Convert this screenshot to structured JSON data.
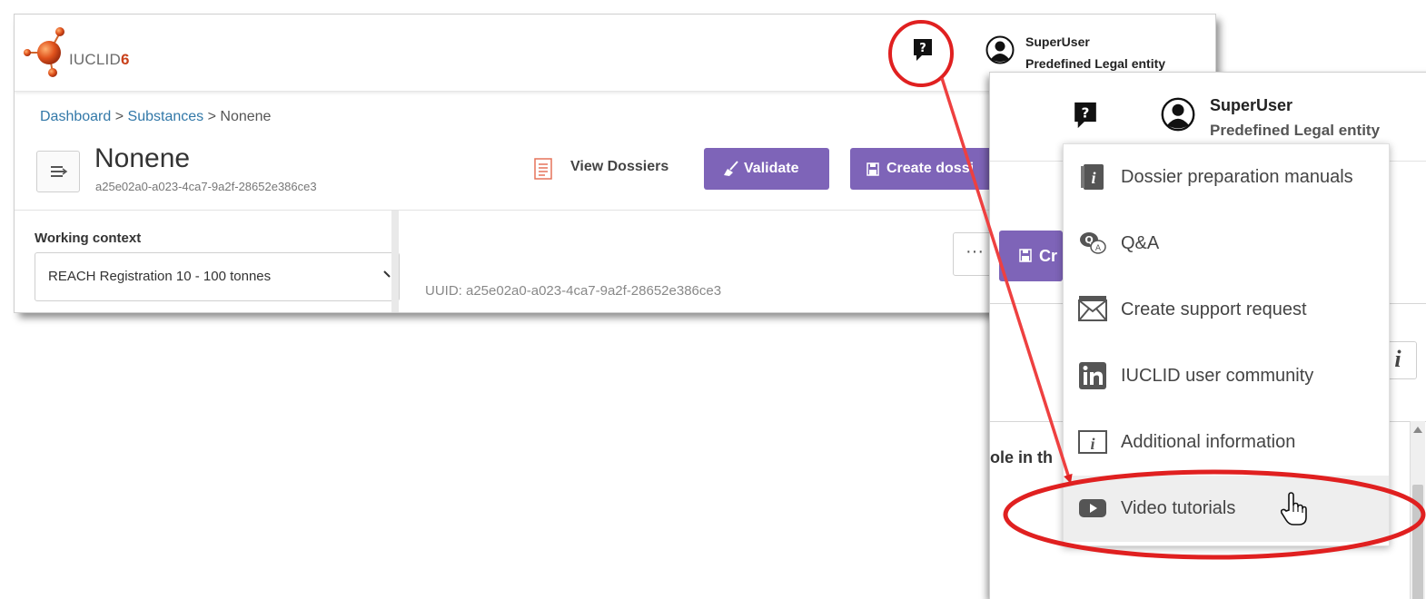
{
  "app": {
    "logo_text": "IUCLID",
    "logo_version": "6"
  },
  "user": {
    "name": "SuperUser",
    "entity": "Predefined Legal entity"
  },
  "breadcrumb": {
    "dashboard": "Dashboard",
    "separator": ">",
    "substances": "Substances",
    "current": "Nonene"
  },
  "page": {
    "title": "Nonene",
    "uuid": "a25e02a0-a023-4ca7-9a2f-28652e386ce3"
  },
  "toolbar": {
    "view_dossiers": "View Dossiers",
    "validate": "Validate",
    "create_dossier": "Create dossi",
    "create_short": "Cr",
    "more": "···"
  },
  "working_context": {
    "label": "Working context",
    "value": "REACH Registration 10 - 100 tonnes"
  },
  "details": {
    "uuid_line": "UUID: a25e02a0-a023-4ca7-9a2f-28652e386ce3",
    "role_text": "ole in th"
  },
  "help_menu": {
    "items": [
      {
        "label": "Dossier preparation manuals",
        "icon": "manual-icon"
      },
      {
        "label": "Q&A",
        "icon": "qa-icon"
      },
      {
        "label": "Create support request",
        "icon": "envelope-icon"
      },
      {
        "label": "IUCLID user community",
        "icon": "linkedin-icon"
      },
      {
        "label": "Additional information",
        "icon": "info-icon"
      },
      {
        "label": "Video tutorials",
        "icon": "video-icon"
      }
    ],
    "hovered_index": 5
  },
  "colors": {
    "accent": "#7e64b8",
    "annotation": "#e02020",
    "link": "#3278a8",
    "logo_orange": "#c9411b"
  }
}
